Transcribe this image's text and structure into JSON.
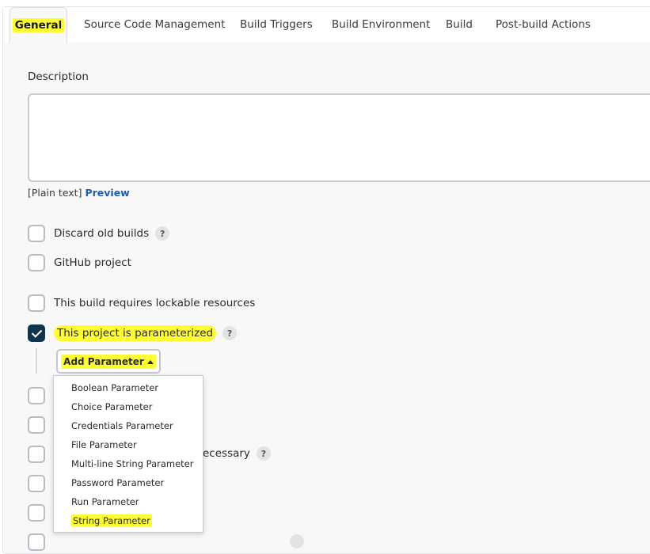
{
  "tabs": {
    "general": "General",
    "scm": "Source Code Management",
    "triggers": "Build Triggers",
    "environment": "Build Environment",
    "build": "Build",
    "post": "Post-build Actions"
  },
  "description": {
    "label": "Description",
    "plain_prefix": "[Plain text]",
    "preview": "Preview"
  },
  "options": {
    "discard": "Discard old builds",
    "github": "GitHub project",
    "lockable": "This build requires lockable resources",
    "parameterized": "This project is parameterized",
    "help": "?",
    "trailing": "ecessary"
  },
  "add_parameter": {
    "label": "Add Parameter",
    "items": [
      "Boolean Parameter",
      "Choice Parameter",
      "Credentials Parameter",
      "File Parameter",
      "Multi-line String Parameter",
      "Password Parameter",
      "Run Parameter",
      "String Parameter"
    ]
  },
  "colors": {
    "highlight": "#fffd33",
    "checked": "#11344f",
    "link": "#1a5fb4"
  }
}
